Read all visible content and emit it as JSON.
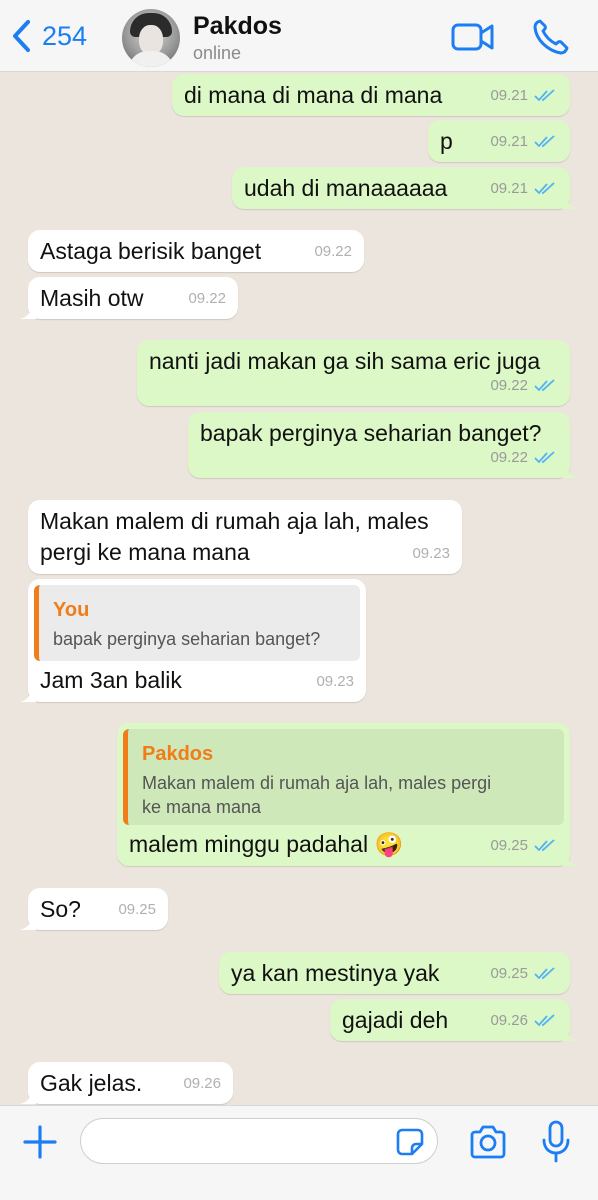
{
  "header": {
    "back_count": "254",
    "contact_name": "Pakdos",
    "contact_status": "online",
    "icons": {
      "back": "chevron-left-icon",
      "video": "video-camera-icon",
      "phone": "phone-icon"
    }
  },
  "messages": [
    {
      "dir": "out",
      "text": "di mana di mana di mana",
      "time": "09.21",
      "read": true
    },
    {
      "dir": "out",
      "text": "p",
      "time": "09.21",
      "read": true
    },
    {
      "dir": "out",
      "text": "udah di manaaaaaa",
      "time": "09.21",
      "read": true
    },
    {
      "dir": "in",
      "text": "Astaga berisik banget",
      "time": "09.22"
    },
    {
      "dir": "in",
      "text": "Masih otw",
      "time": "09.22"
    },
    {
      "dir": "out",
      "text": "nanti jadi makan ga sih sama eric juga",
      "time": "09.22",
      "read": true
    },
    {
      "dir": "out",
      "text": "bapak perginya seharian banget?",
      "time": "09.22",
      "read": true
    },
    {
      "dir": "in",
      "text": "Makan malem di rumah aja lah, males\npergi ke mana mana",
      "time": "09.23"
    },
    {
      "dir": "in",
      "text": "Jam 3an balik",
      "time": "09.23",
      "quote": {
        "name": "You",
        "text": "bapak perginya seharian banget?"
      }
    },
    {
      "dir": "out",
      "text": "malem minggu padahal 🤪",
      "time": "09.25",
      "read": true,
      "quote": {
        "name": "Pakdos",
        "text": "Makan malem di rumah aja lah, males pergi\nke mana mana"
      }
    },
    {
      "dir": "in",
      "text": "So?",
      "time": "09.25"
    },
    {
      "dir": "out",
      "text": "ya kan mestinya yak",
      "time": "09.25",
      "read": true
    },
    {
      "dir": "out",
      "text": "gajadi deh",
      "time": "09.26",
      "read": true
    },
    {
      "dir": "in",
      "text": "Gak jelas.",
      "time": "09.26"
    }
  ],
  "input": {
    "placeholder": ""
  },
  "bottom_icons": {
    "plus": "plus-icon",
    "sticker": "sticker-icon",
    "camera": "camera-icon",
    "mic": "microphone-icon"
  },
  "colors": {
    "accent": "#1b7ef2",
    "outgoing_bubble": "#dcf8c6",
    "incoming_bubble": "#ffffff",
    "chat_background": "#ece5dd",
    "quote_name": "#f07c1a",
    "read_ticks": "#4fb3f6"
  }
}
